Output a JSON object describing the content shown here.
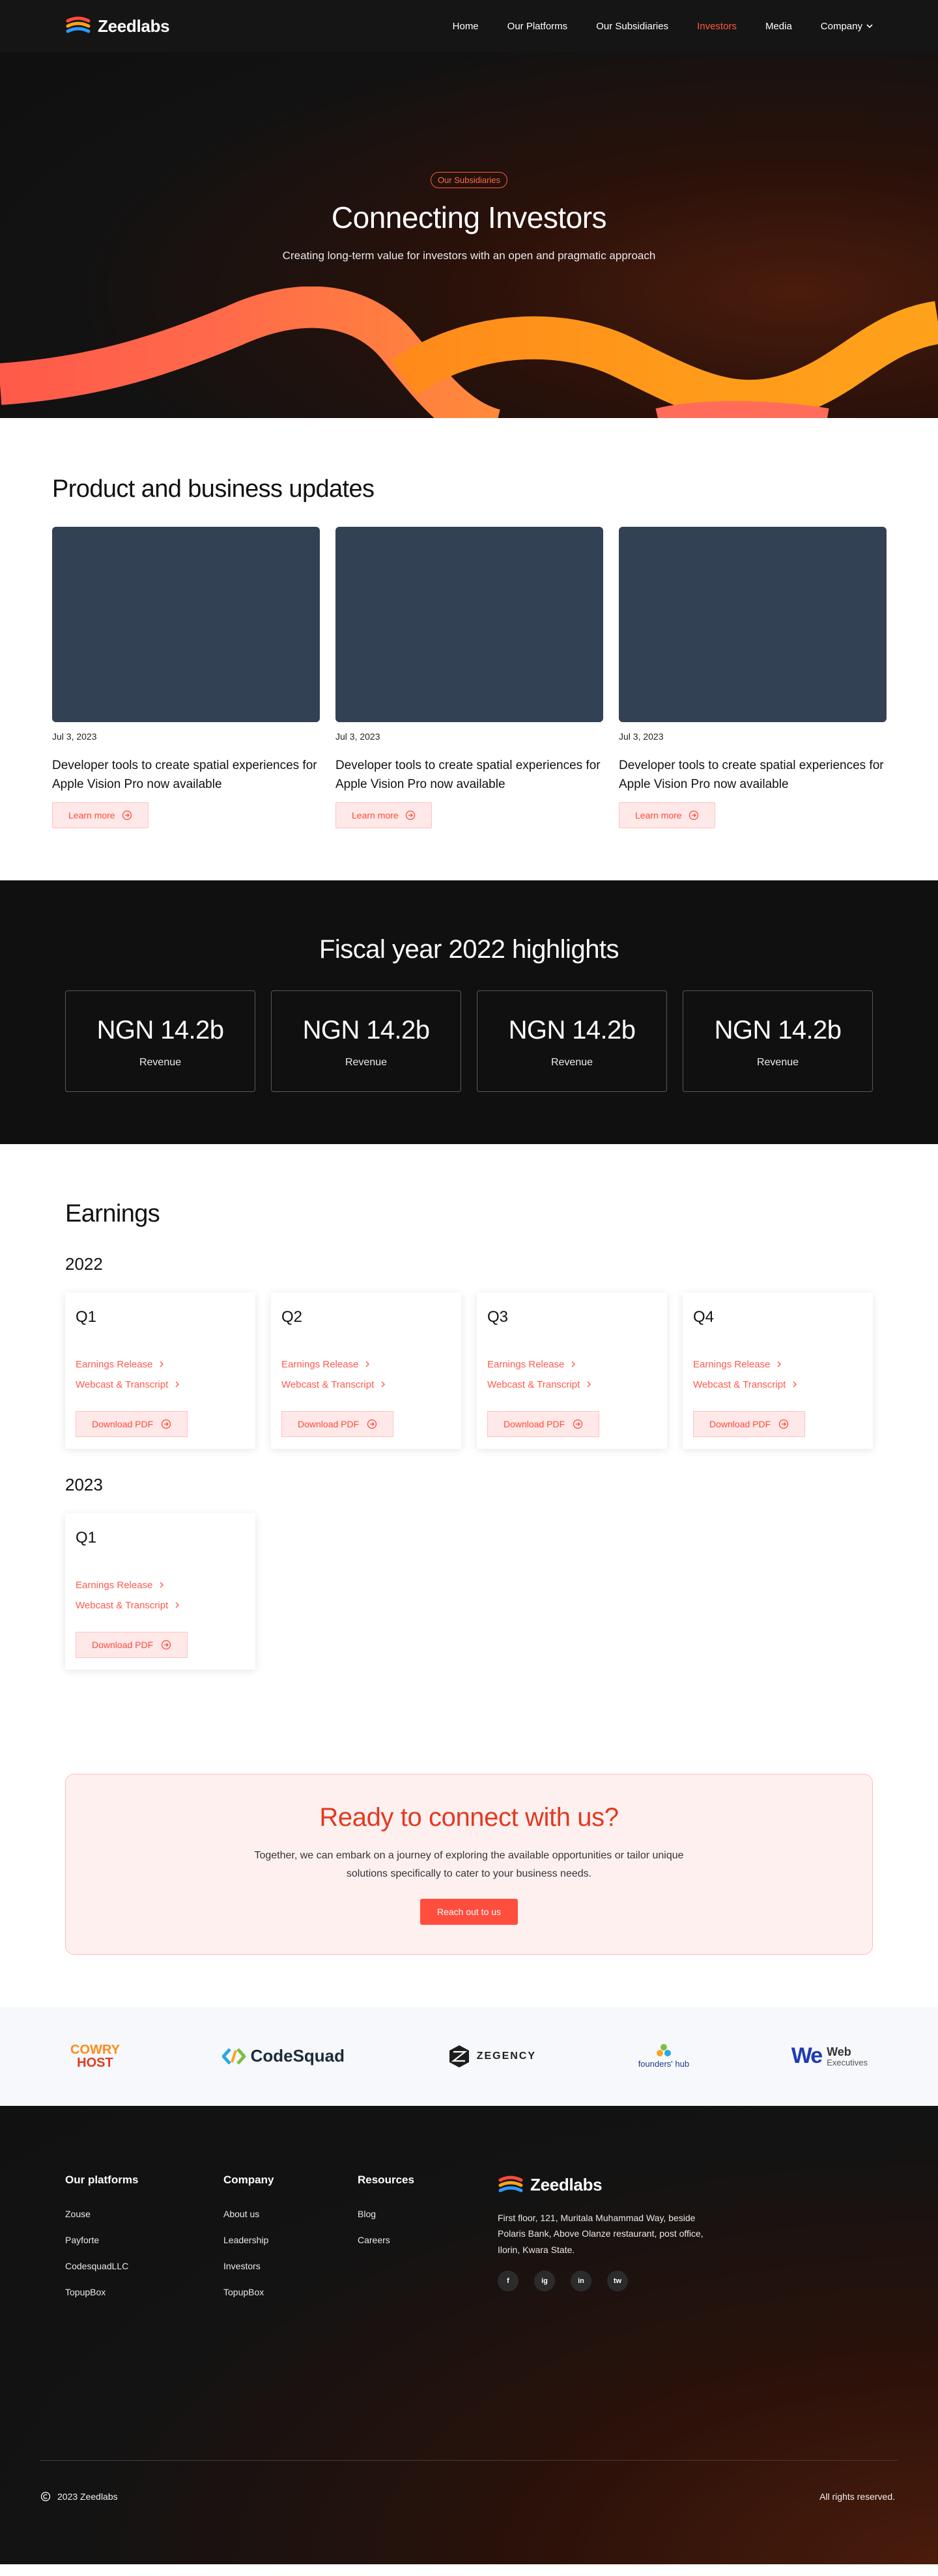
{
  "nav": {
    "brand": "Zeedlabs",
    "links": [
      "Home",
      "Our Platforms",
      "Our Subsidiaries",
      "Investors",
      "Media",
      "Company"
    ]
  },
  "hero": {
    "badge": "Our Subsidiaries",
    "title": "Connecting Investors",
    "subtitle": "Creating long-term value for investors with an open and pragmatic approach"
  },
  "updates": {
    "heading": "Product and business updates",
    "cards": [
      {
        "date": "Jul 3, 2023",
        "title": "Developer tools to create spatial experiences for Apple Vision Pro now available",
        "cta": "Learn more"
      },
      {
        "date": "Jul 3, 2023",
        "title": "Developer tools to create spatial experiences for Apple Vision Pro now available",
        "cta": "Learn more"
      },
      {
        "date": "Jul 3, 2023",
        "title": "Developer tools to create spatial experiences for Apple Vision Pro now available",
        "cta": "Learn more"
      }
    ]
  },
  "fiscal": {
    "heading": "Fiscal year 2022 highlights",
    "cards": [
      {
        "value": "NGN 14.2b",
        "label": "Revenue"
      },
      {
        "value": "NGN 14.2b",
        "label": "Revenue"
      },
      {
        "value": "NGN 14.2b",
        "label": "Revenue"
      },
      {
        "value": "NGN 14.2b",
        "label": "Revenue"
      }
    ]
  },
  "earnings": {
    "heading": "Earnings",
    "link1": "Earnings Release",
    "link2": "Webcast & Transcript",
    "button": "Download PDF",
    "years": [
      {
        "year": "2022",
        "quarters": [
          "Q1",
          "Q2",
          "Q3",
          "Q4"
        ]
      },
      {
        "year": "2023",
        "quarters": [
          "Q1"
        ]
      }
    ]
  },
  "cta": {
    "title": "Ready to connect with us?",
    "text": "Together, we can embark on a journey of exploring the available opportunities or tailor unique solutions specifically  to cater to your business needs.",
    "button": "Reach out to us"
  },
  "partners": {
    "cowry_line1": "COWRY",
    "cowry_line2": "HOST",
    "codesquad": "CodeSquad",
    "zegency": "ZEGENCY",
    "founders": "founders' hub",
    "web_line1": "Web",
    "web_line2": "Executives"
  },
  "footer": {
    "col1": {
      "heading": "Our platforms",
      "items": [
        "Zouse",
        "Payforte",
        "CodesquadLLC",
        "TopupBox"
      ]
    },
    "col2": {
      "heading": "Company",
      "items": [
        "About us",
        "Leadership",
        "Investors",
        "TopupBox"
      ]
    },
    "col3": {
      "heading": "Resources",
      "items": [
        "Blog",
        "Careers"
      ]
    },
    "brand": "Zeedlabs",
    "address": "First floor, 121, Muritala Muhammad Way, beside Polaris Bank, Above Olanze restaurant, post office, Ilorin, Kwara State.",
    "socials": [
      "f",
      "ig",
      "in",
      "tw"
    ],
    "copyright": "2023 Zeedlabs",
    "rights": "All rights reserved."
  },
  "colors": {
    "accent": "#ff5a3c",
    "dark": "#101010",
    "card": "#334155",
    "pink_bg": "#fff0f0"
  }
}
